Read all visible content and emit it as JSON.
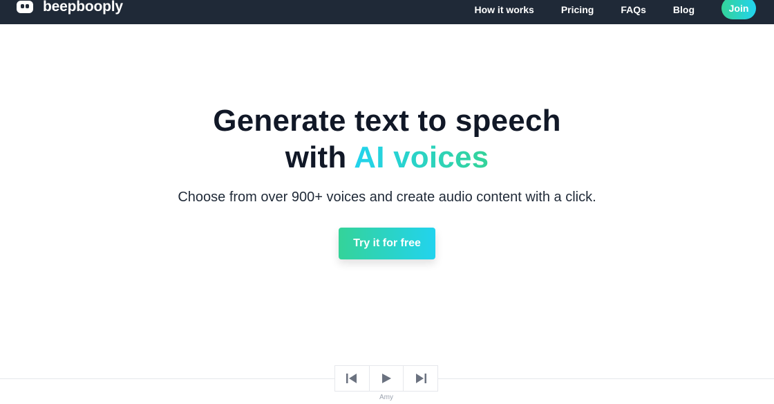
{
  "header": {
    "brand": "beepbooply",
    "logo_icon": "robot-face-icon",
    "nav": [
      {
        "label": "How it works"
      },
      {
        "label": "Pricing"
      },
      {
        "label": "FAQs"
      },
      {
        "label": "Blog"
      }
    ],
    "join_label": "Join"
  },
  "hero": {
    "title_line1": "Generate text to speech",
    "title_line2_prefix": "with ",
    "title_line2_accent": "AI voices",
    "subtitle": "Choose from over 900+ voices and create audio content with a click.",
    "cta_label": "Try it for free"
  },
  "player": {
    "prev_icon": "skip-previous-icon",
    "play_icon": "play-icon",
    "next_icon": "skip-next-icon",
    "voice_name": "Amy"
  },
  "colors": {
    "header_bg": "#1f2937",
    "accent_start": "#34d399",
    "accent_end": "#22d3ee",
    "headline": "#111827"
  }
}
